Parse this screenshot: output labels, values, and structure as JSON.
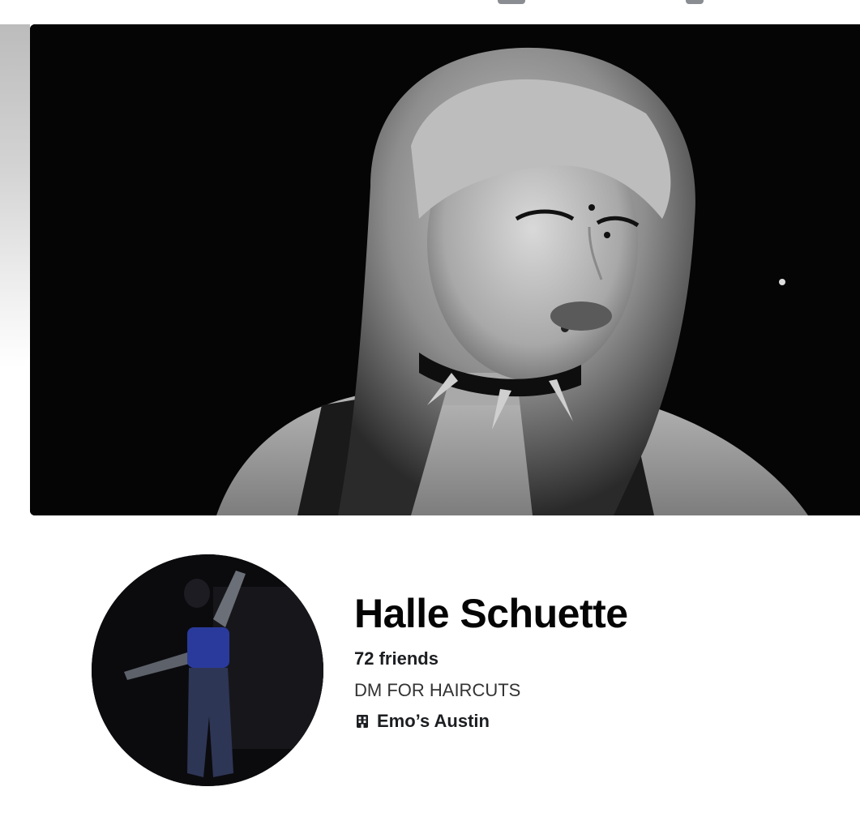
{
  "profile": {
    "name": "Halle Schuette",
    "friends": "72 friends",
    "bio": "DM FOR HAIRCUTS",
    "workplace": {
      "icon": "building-icon",
      "label": "Emo’s Austin"
    }
  },
  "images": {
    "cover_photo": "cover-photo",
    "profile_picture": "profile-picture"
  },
  "colors": {
    "background": "#ffffff",
    "text_primary": "#050505",
    "cover_background": "#050505"
  }
}
